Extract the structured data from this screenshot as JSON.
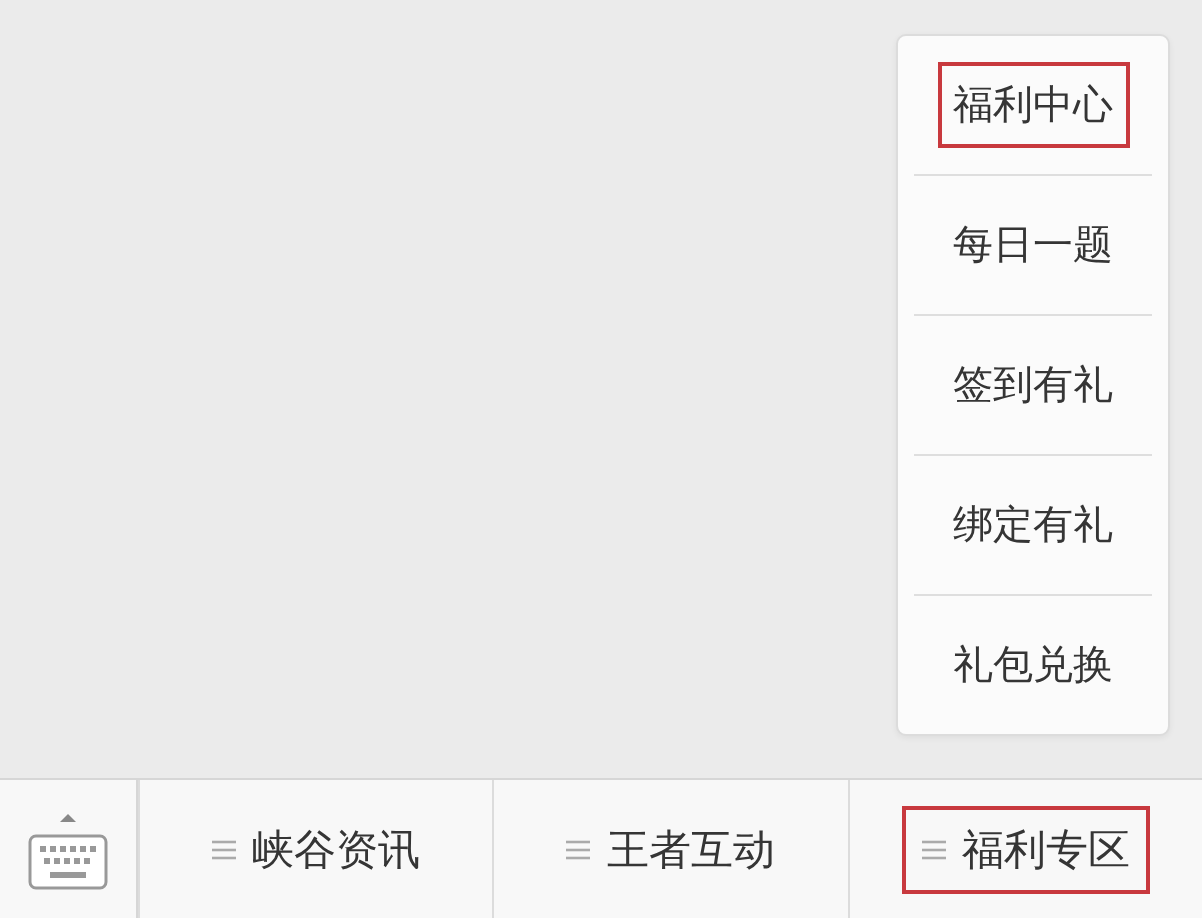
{
  "popup_menu": {
    "items": [
      {
        "label": "福利中心",
        "highlighted": true
      },
      {
        "label": "每日一题",
        "highlighted": false
      },
      {
        "label": "签到有礼",
        "highlighted": false
      },
      {
        "label": "绑定有礼",
        "highlighted": false
      },
      {
        "label": "礼包兑换",
        "highlighted": false
      }
    ]
  },
  "menu_bar": {
    "items": [
      {
        "label": "峡谷资讯",
        "highlighted": false
      },
      {
        "label": "王者互动",
        "highlighted": false
      },
      {
        "label": "福利专区",
        "highlighted": true
      }
    ]
  }
}
